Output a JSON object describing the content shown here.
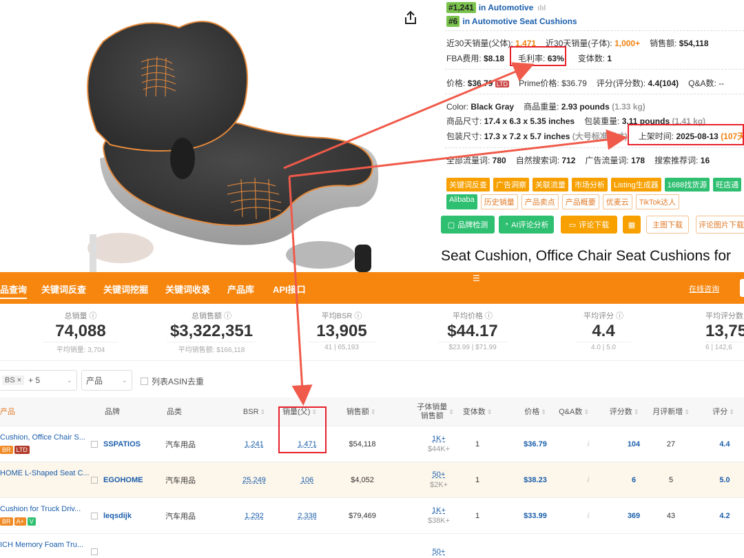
{
  "info": {
    "rank1": {
      "num": "#1,241",
      "in": "in",
      "category": "Automotive"
    },
    "rank2": {
      "num": "#6",
      "in": "in",
      "category": "Automotive Seat Cushions"
    },
    "sales": {
      "parent_label": "近30天销量(父体): ",
      "parent_value": "1,471",
      "child_label": "近30天销量(子体): ",
      "child_value": "1,000+",
      "revenue_label": "销售额: ",
      "revenue_value": "$54,118"
    },
    "fba": {
      "fee_label": "FBA费用: ",
      "fee_value": "$8.18",
      "margin_label": "毛利率: ",
      "margin_value": "63%",
      "variants_label": "变体数: ",
      "variants_value": "1"
    },
    "price": {
      "label": "价格: ",
      "value": "$36.79",
      "ltd": "LTD",
      "prime_label": "Prime价格: ",
      "prime_value": "$36.79",
      "rating_label": "评分(评分数): ",
      "rating_value": "4.4(104)",
      "qa_label": "Q&A数: ",
      "qa_value": "--"
    },
    "details": {
      "color_label": "Color: ",
      "color_value": "Black Gray",
      "weight_label": "商品重量: ",
      "weight_value": "2.93 pounds",
      "weight_kg": "(1.33 kg)",
      "size_label": "商品尺寸: ",
      "size_value": "17.4 x 6.3 x 5.35 inches",
      "pkg_weight_label": "包装重量: ",
      "pkg_weight_value": "3.11 pounds",
      "pkg_weight_kg": "(1.41 kg)",
      "pkg_size_label": "包装尺寸: ",
      "pkg_size_value": "17.3 x 7.2 x 5.7 inches",
      "pkg_size_note": "(大号标准尺寸)",
      "listed_label": "上架时间: ",
      "listed_value": "2025-08-13",
      "listed_days": "(107天"
    },
    "traffic": {
      "all_label": "全部流量词: ",
      "all_value": "780",
      "natural_label": "自然搜索词: ",
      "natural_value": "712",
      "ad_label": "广告流量词: ",
      "ad_value": "178",
      "rec_label": "搜索推荐词: ",
      "rec_value": "16"
    },
    "tags1": [
      "关键词反查",
      "广告洞察",
      "关联流量",
      "市场分析",
      "Listing生成器",
      "1688找货源",
      "旺店通"
    ],
    "tags2": [
      "Alibaba",
      "历史销量",
      "产品卖点",
      "产品概要",
      "优麦云",
      "TikTok达人"
    ],
    "actions": [
      "品牌检测",
      "AI评论分析",
      "评论下载",
      "主图下载",
      "评论图片下载"
    ],
    "title": "Seat Cushion, Office Chair Seat Cushions for"
  },
  "plugin": {
    "nav": [
      "品查询",
      "关键词反查",
      "关键词挖掘",
      "关键词收录",
      "产品库",
      "API接口"
    ],
    "consult": "在线咨询",
    "stats": [
      {
        "label": "总销量 ⓘ",
        "value": "74,088",
        "sub": "平均销量: 3,704"
      },
      {
        "label": "总销售额 ⓘ",
        "value": "$3,322,351",
        "sub": "平均销售额: $166,118"
      },
      {
        "label": "平均BSR ⓘ",
        "value": "13,905",
        "sub": "41 | 65,193"
      },
      {
        "label": "平均价格 ⓘ",
        "value": "$44.17",
        "sub": "$23.99 | $71.99"
      },
      {
        "label": "平均评分 ⓘ",
        "value": "4.4",
        "sub": "4.0 | 5.0"
      },
      {
        "label": "平均评分数",
        "value": "13,75",
        "sub": "6 | 142,6"
      }
    ],
    "filters": {
      "chip": "BS",
      "more": "+ 5",
      "type": "产品",
      "dedupe": "列表ASIN去重"
    },
    "headers": [
      "产品",
      "品牌",
      "品类",
      "BSR",
      "销量(父)",
      "销售额",
      "子体销量\n销售额",
      "变体数",
      "价格",
      "Q&A数",
      "评分数",
      "月评新增",
      "评分"
    ],
    "rows": [
      {
        "name": "Cushion, Office Chair S...",
        "badges": [
          [
            "BR",
            "org"
          ],
          [
            "LTD",
            "dred"
          ]
        ],
        "brand": "SSPATIOS",
        "category": "汽车用品",
        "bsr": "1,241",
        "sales": "1,471",
        "revenue": "$54,118",
        "child_sales": "1K+",
        "child_rev": "$44K+",
        "variants": "1",
        "price": "$36.79",
        "qa": "i",
        "reviews": "104",
        "monthly": "27",
        "rating": "4.4"
      },
      {
        "name": "HOME L-Shaped Seat C...",
        "badges": [],
        "brand": "EGOHOME",
        "category": "汽车用品",
        "bsr": "25,249",
        "sales": "106",
        "revenue": "$4,052",
        "child_sales": "50+",
        "child_rev": "$2K+",
        "variants": "1",
        "price": "$38.23",
        "qa": "i",
        "reviews": "6",
        "monthly": "5",
        "rating": "5.0"
      },
      {
        "name": "Cushion for Truck Driv...",
        "badges": [
          [
            "BR",
            "org"
          ],
          [
            "A+",
            "org"
          ],
          [
            "V",
            "grn"
          ]
        ],
        "brand": "leqsdijk",
        "category": "汽车用品",
        "bsr": "1,292",
        "sales": "2,338",
        "revenue": "$79,469",
        "child_sales": "1K+",
        "child_rev": "$38K+",
        "variants": "1",
        "price": "$33.99",
        "qa": "i",
        "reviews": "369",
        "monthly": "43",
        "rating": "4.2"
      },
      {
        "name": "ICH Memory Foam Tru...",
        "badges": [],
        "brand": "",
        "category": "",
        "bsr": "",
        "sales": "",
        "revenue": "",
        "child_sales": "50+",
        "child_rev": "",
        "variants": "",
        "price": "",
        "qa": "",
        "reviews": "",
        "monthly": "",
        "rating": ""
      }
    ]
  }
}
